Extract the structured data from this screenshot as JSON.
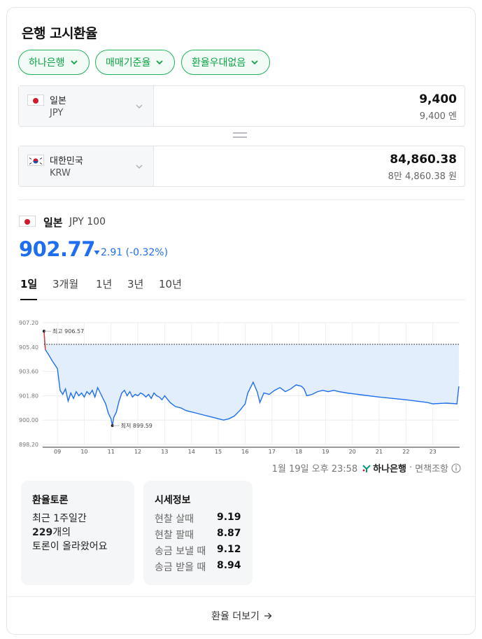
{
  "title": "은행 고시환율",
  "filters": [
    {
      "label": "하나은행"
    },
    {
      "label": "매매기준율"
    },
    {
      "label": "환율우대없음"
    }
  ],
  "converter": {
    "from": {
      "country": "일본",
      "code": "JPY",
      "amount": "9,400",
      "amount_text": "9,400 엔"
    },
    "to": {
      "country": "대한민국",
      "code": "KRW",
      "amount": "84,860.38",
      "amount_text": "8만 4,860.38 원"
    }
  },
  "currency": {
    "name": "일본",
    "code": "JPY 100",
    "rate": "902.77",
    "change": "2.91 (-0.32%)",
    "change_direction": "down"
  },
  "periods": [
    {
      "label": "1일",
      "active": true
    },
    {
      "label": "3개월",
      "active": false
    },
    {
      "label": "1년",
      "active": false
    },
    {
      "label": "3년",
      "active": false
    },
    {
      "label": "10년",
      "active": false
    }
  ],
  "chart_data": {
    "type": "area",
    "x_ticks": [
      "09",
      "10",
      "11",
      "12",
      "13",
      "14",
      "15",
      "16",
      "17",
      "18",
      "19",
      "20",
      "21",
      "22",
      "23"
    ],
    "y_ticks": [
      "907.20",
      "905.40",
      "903.60",
      "901.80",
      "900.00",
      "898.20"
    ],
    "ylim": [
      898.2,
      907.2
    ],
    "xlim": [
      8.45,
      24.0
    ],
    "reference_line": 905.6,
    "max_label": "최고 906.57",
    "min_label": "최저 899.59",
    "max_point": {
      "x": 8.5,
      "y": 906.57
    },
    "min_point": {
      "x": 11.05,
      "y": 899.59
    },
    "series": [
      {
        "color": "#1f6ef0",
        "fill": "#e3eefc",
        "points": [
          [
            8.5,
            906.57
          ],
          [
            8.55,
            905.2
          ],
          [
            8.65,
            904.9
          ],
          [
            8.8,
            904.4
          ],
          [
            9.0,
            903.8
          ],
          [
            9.1,
            902.2
          ],
          [
            9.2,
            901.9
          ],
          [
            9.3,
            902.3
          ],
          [
            9.4,
            901.4
          ],
          [
            9.5,
            902.0
          ],
          [
            9.6,
            901.6
          ],
          [
            9.7,
            902.1
          ],
          [
            9.8,
            901.8
          ],
          [
            9.9,
            902.0
          ],
          [
            10.0,
            901.7
          ],
          [
            10.1,
            902.1
          ],
          [
            10.2,
            901.9
          ],
          [
            10.3,
            902.2
          ],
          [
            10.4,
            901.7
          ],
          [
            10.5,
            902.4
          ],
          [
            10.6,
            902.0
          ],
          [
            10.7,
            901.6
          ],
          [
            10.8,
            901.2
          ],
          [
            10.9,
            900.5
          ],
          [
            11.0,
            900.1
          ],
          [
            11.05,
            899.59
          ],
          [
            11.1,
            900.2
          ],
          [
            11.2,
            900.6
          ],
          [
            11.3,
            901.4
          ],
          [
            11.4,
            902.0
          ],
          [
            11.5,
            902.2
          ],
          [
            11.6,
            901.8
          ],
          [
            11.7,
            902.1
          ],
          [
            11.8,
            901.7
          ],
          [
            11.9,
            901.9
          ],
          [
            12.0,
            901.8
          ],
          [
            12.1,
            902.0
          ],
          [
            12.2,
            901.9
          ],
          [
            12.3,
            901.7
          ],
          [
            12.4,
            901.9
          ],
          [
            12.5,
            901.6
          ],
          [
            12.6,
            902.0
          ],
          [
            12.7,
            901.8
          ],
          [
            12.8,
            901.7
          ],
          [
            12.9,
            901.5
          ],
          [
            13.0,
            901.8
          ],
          [
            13.2,
            901.3
          ],
          [
            13.4,
            901.0
          ],
          [
            13.6,
            900.9
          ],
          [
            13.8,
            900.7
          ],
          [
            14.0,
            900.6
          ],
          [
            14.2,
            900.5
          ],
          [
            14.4,
            900.4
          ],
          [
            14.6,
            900.3
          ],
          [
            14.8,
            900.2
          ],
          [
            15.0,
            900.1
          ],
          [
            15.2,
            900.0
          ],
          [
            15.4,
            900.1
          ],
          [
            15.6,
            900.3
          ],
          [
            15.8,
            900.7
          ],
          [
            16.0,
            901.2
          ],
          [
            16.1,
            902.0
          ],
          [
            16.3,
            902.8
          ],
          [
            16.45,
            902.1
          ],
          [
            16.55,
            901.3
          ],
          [
            16.7,
            902.0
          ],
          [
            16.9,
            901.9
          ],
          [
            17.1,
            902.2
          ],
          [
            17.3,
            902.4
          ],
          [
            17.5,
            902.1
          ],
          [
            17.7,
            902.3
          ],
          [
            17.9,
            902.6
          ],
          [
            18.1,
            902.5
          ],
          [
            18.2,
            902.3
          ],
          [
            18.3,
            901.8
          ],
          [
            18.5,
            901.9
          ],
          [
            18.7,
            902.1
          ],
          [
            18.9,
            902.2
          ],
          [
            19.1,
            902.1
          ],
          [
            19.3,
            902.2
          ],
          [
            19.5,
            902.1
          ],
          [
            19.8,
            902.0
          ],
          [
            20.2,
            901.9
          ],
          [
            21.0,
            901.7
          ],
          [
            22.0,
            901.5
          ],
          [
            22.8,
            901.3
          ],
          [
            23.0,
            901.2
          ],
          [
            23.5,
            901.25
          ],
          [
            23.9,
            901.2
          ],
          [
            23.97,
            902.5
          ]
        ]
      }
    ]
  },
  "updated": "1월 19일 오후 23:58",
  "source": "하나은행",
  "disclaimer": "면책조항",
  "discussion": {
    "title": "환율토론",
    "line1": "최근 1주일간",
    "count": "229",
    "count_suffix": "개의",
    "line3": "토론이 올라왔어요"
  },
  "market": {
    "title": "시세정보",
    "rows": [
      {
        "label": "현찰 살때",
        "value": "9.19"
      },
      {
        "label": "현찰 팔때",
        "value": "8.87"
      },
      {
        "label": "송금 보낼 때",
        "value": "9.12"
      },
      {
        "label": "송금 받을 때",
        "value": "8.94"
      }
    ]
  },
  "more_label": "환율 더보기"
}
